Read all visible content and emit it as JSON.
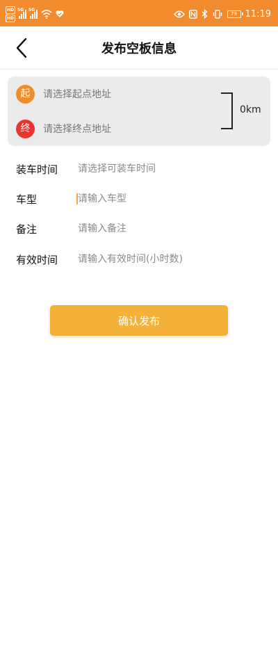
{
  "status_bar": {
    "hd_badge_top": "HD",
    "hd_badge_bottom": "HD",
    "network_1": "5G",
    "network_2": "5G",
    "battery": "79",
    "time": "11:19"
  },
  "header": {
    "back_icon": "chevron-left-icon",
    "title": "发布空板信息"
  },
  "address": {
    "start_badge": "起",
    "start_placeholder": "请选择起点地址",
    "end_badge": "终",
    "end_placeholder": "请选择终点地址",
    "distance": "0km"
  },
  "form": {
    "fields": [
      {
        "label": "装车时间",
        "placeholder": "请选择可装车时间",
        "value": ""
      },
      {
        "label": "车型",
        "placeholder": "请输入车型",
        "value": ""
      },
      {
        "label": "备注",
        "placeholder": "请输入备注",
        "value": ""
      },
      {
        "label": "有效时间",
        "placeholder": "请输入有效时间(小时数)",
        "value": ""
      }
    ]
  },
  "actions": {
    "confirm_label": "确认发布"
  },
  "colors": {
    "status_bar": "#f28a2e",
    "start_badge": "#ec8e2b",
    "end_badge": "#e8352e",
    "confirm_button": "#f4b13a",
    "cursor": "#f3a73a"
  }
}
